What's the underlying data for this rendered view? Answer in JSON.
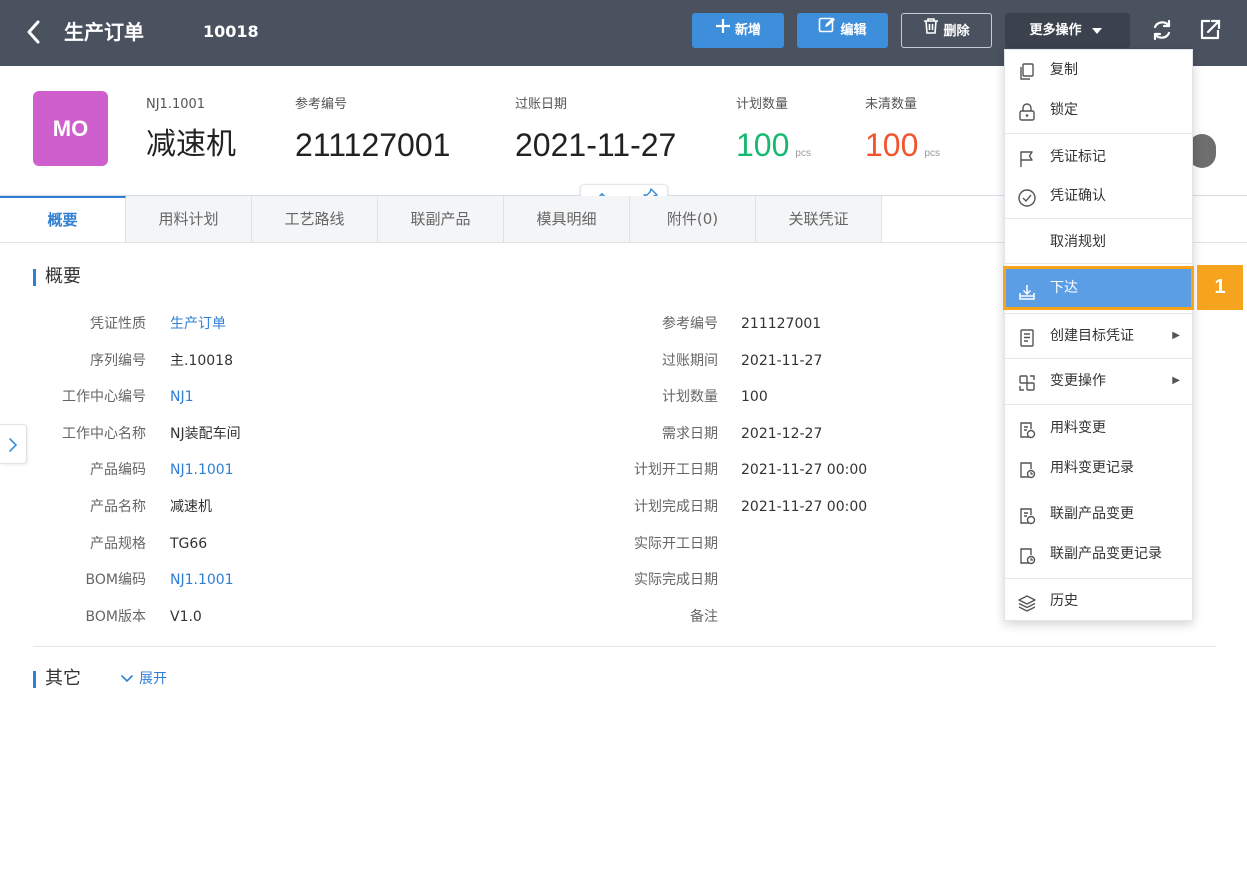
{
  "topbar": {
    "title": "生产订单",
    "doc_no": "10018",
    "add_label": "新增",
    "edit_label": "编辑",
    "delete_label": "删除",
    "more_label": "更多操作"
  },
  "header": {
    "avatar_text": "MO",
    "product_code": "NJ1.1001",
    "product_name": "减速机",
    "ref_no_label": "参考编号",
    "ref_no": "211127001",
    "post_date_label": "过账日期",
    "post_date": "2021-11-27",
    "plan_qty_label": "计划数量",
    "plan_qty": "100",
    "plan_qty_unit": "pcs",
    "open_qty_label": "未清数量",
    "open_qty": "100",
    "open_qty_unit": "pcs"
  },
  "tabs": [
    "概要",
    "用料计划",
    "工艺路线",
    "联副产品",
    "模具明细",
    "附件(0)",
    "关联凭证"
  ],
  "overview": {
    "section_title": "概要",
    "left_fields": [
      {
        "label": "凭证性质",
        "value": "生产订单"
      },
      {
        "label": "序列编号",
        "value": "主.10018"
      },
      {
        "label": "工作中心编号",
        "value": "NJ1"
      },
      {
        "label": "工作中心名称",
        "value": "NJ装配车间"
      },
      {
        "label": "产品编码",
        "value": "NJ1.1001"
      },
      {
        "label": "产品名称",
        "value": "减速机"
      },
      {
        "label": "产品规格",
        "value": "TG66"
      },
      {
        "label": "BOM编码",
        "value": "NJ1.1001"
      },
      {
        "label": "BOM版本",
        "value": "V1.0"
      }
    ],
    "right_fields": [
      {
        "label": "参考编号",
        "value": "211127001"
      },
      {
        "label": "过账期间",
        "value": "2021-11-27"
      },
      {
        "label": "计划数量",
        "value": "100"
      },
      {
        "label": "需求日期",
        "value": "2021-12-27"
      },
      {
        "label": "计划开工日期",
        "value": "2021-11-27 00:00"
      },
      {
        "label": "计划完成日期",
        "value": "2021-11-27 00:00"
      },
      {
        "label": "实际开工日期",
        "value": ""
      },
      {
        "label": "实际完成日期",
        "value": ""
      },
      {
        "label": "备注",
        "value": ""
      }
    ]
  },
  "other": {
    "section_title": "其它",
    "expand_label": "展开"
  },
  "menu": {
    "items": [
      {
        "label": "复制",
        "icon": "copy-icon"
      },
      {
        "label": "锁定",
        "icon": "lock-icon"
      },
      {
        "label": "凭证标记",
        "icon": "flag-icon"
      },
      {
        "label": "凭证确认",
        "icon": "check-circle-icon"
      },
      {
        "label": "取消规划",
        "icon": ""
      },
      {
        "label": "下达",
        "icon": "release-icon"
      },
      {
        "label": "创建目标凭证",
        "icon": "document-icon"
      },
      {
        "label": "变更操作",
        "icon": "change-icon"
      },
      {
        "label": "用料变更",
        "icon": "material-change-icon"
      },
      {
        "label": "用料变更记录",
        "icon": "material-change-log-icon"
      },
      {
        "label": "联副产品变更",
        "icon": "coproduct-change-icon"
      },
      {
        "label": "联副产品变更记录",
        "icon": "coproduct-change-log-icon"
      },
      {
        "label": "历史",
        "icon": "layers-icon"
      }
    ],
    "highlighted": "下达"
  },
  "callout": {
    "number": "1"
  },
  "colors": {
    "topbar": "#4a5260",
    "primary": "#3d8fdb",
    "accent_link": "#2f7fd4",
    "avatar": "#cf5fcc",
    "plan_qty": "#17b870",
    "open_qty": "#f2542d",
    "highlight": "#5c9ee6",
    "callout": "#f6a31e"
  }
}
